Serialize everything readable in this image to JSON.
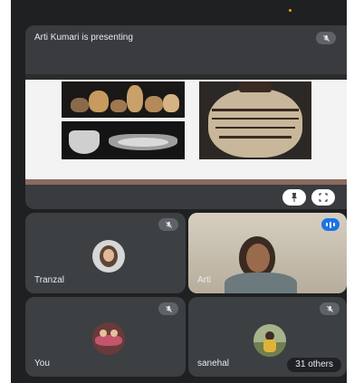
{
  "presentation": {
    "title": "Arti Kumari is presenting",
    "mic_icon": "mic-off-icon",
    "actions": [
      "pin-icon",
      "fullscreen-icon"
    ]
  },
  "participants": [
    {
      "name": "Tranzal",
      "mic": "muted"
    },
    {
      "name": "Arti",
      "mic": "speaking"
    },
    {
      "name": "You",
      "mic": "muted"
    },
    {
      "name": "sanehal",
      "mic": "muted",
      "others": "31 others"
    }
  ],
  "colors": {
    "background": "#1f2022",
    "tile": "#3c4043",
    "speaking": "#1a73e8"
  }
}
